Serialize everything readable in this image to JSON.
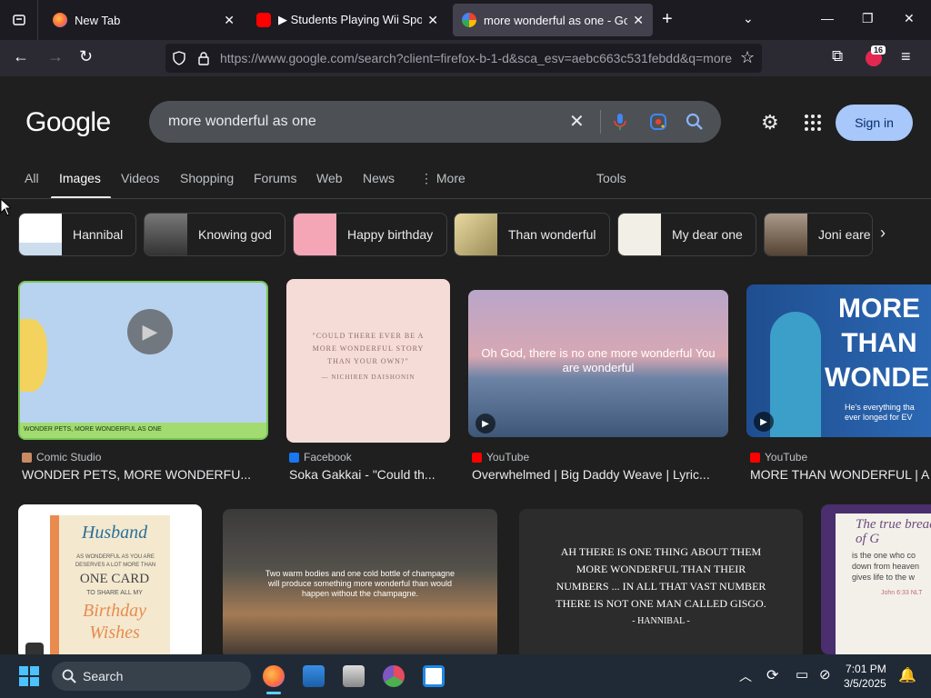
{
  "browser": {
    "tabs": [
      {
        "title": "New Tab",
        "favicon": "firefox-icon"
      },
      {
        "title": "▶ Students Playing Wii Sports -",
        "favicon": "youtube-icon"
      },
      {
        "title": "more wonderful as one - Googl",
        "favicon": "google-icon"
      }
    ],
    "url_main": "https://www.google.com",
    "url_rest": "/search?client=firefox-b-1-d&sca_esv=aebc663c531febdd&q=more",
    "extension_badge": "16"
  },
  "google": {
    "logo": "Google",
    "query": "more wonderful as one",
    "signin_label": "Sign in",
    "tabs": [
      "All",
      "Images",
      "Videos",
      "Shopping",
      "Forums",
      "Web",
      "News",
      "More",
      "Tools"
    ],
    "chips": [
      "Hannibal",
      "Knowing god",
      "Happy birthday",
      "Than wonderful",
      "My dear one",
      "Joni eare"
    ],
    "results": [
      {
        "source": "Comic Studio",
        "title": "WONDER PETS, MORE WONDERFU...",
        "caption": "WONDER PETS, MORE WONDERFUL AS ONE"
      },
      {
        "source": "Facebook",
        "title": "Soka Gakkai - \"Could th...",
        "quote": "\"COULD THERE EVER BE A MORE WONDERFUL STORY THAN YOUR OWN?\"",
        "attribution": "— NICHIREN DAISHONIN"
      },
      {
        "source": "YouTube",
        "title": "Overwhelmed | Big Daddy Weave | Lyric...",
        "overlay": "Oh God, there is no one more wonderful You are wonderful"
      },
      {
        "source": "YouTube",
        "title": "MORE THAN WONDERFUL | A",
        "overlay": "MORE THAN WONDERF",
        "sub": "He's everything tha ever longed for EV"
      }
    ],
    "row2": {
      "card1": {
        "l1": "Husband",
        "l2": "AS WONDERFUL AS YOU ARE DESERVES A LOT MORE THAN",
        "l3": "ONE CARD",
        "l4": "TO SHARE ALL MY",
        "l5": "Birthday",
        "l6": "Wishes"
      },
      "card2": {
        "text": "Two warm bodies and one cold bottle of champagne will produce something more wonderful than would happen without the champagne."
      },
      "card3": {
        "text": "AH THERE IS ONE THING ABOUT THEM MORE WONDERFUL THAN THEIR NUMBERS ... IN ALL THAT VAST NUMBER THERE IS NOT ONE MAN CALLED GISGO.",
        "attribution": "- HANNIBAL -"
      },
      "card4": {
        "l1": "The true bread of G",
        "l2": "is the one who co down from heaven gives life to the w",
        "ref": "John 6:33 NLT"
      }
    }
  },
  "taskbar": {
    "search_label": "Search",
    "time": "7:01 PM",
    "date": "3/5/2025"
  }
}
